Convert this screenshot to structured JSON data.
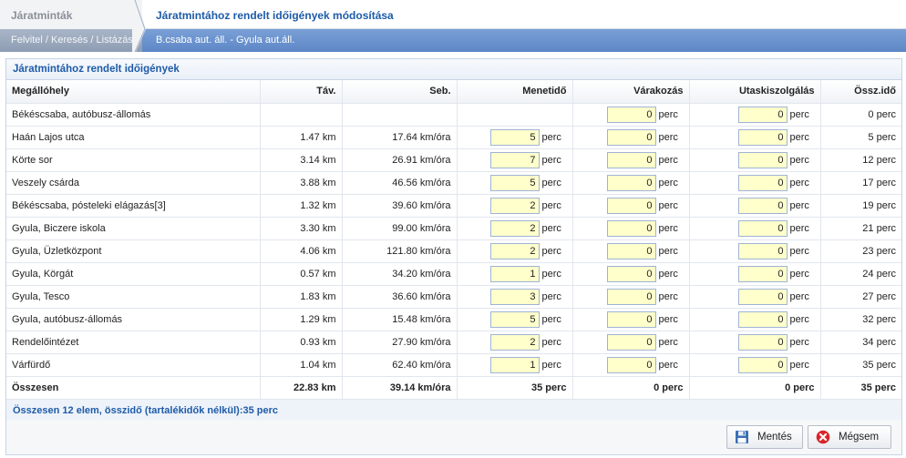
{
  "breadcrumb": {
    "root": "Járatminták",
    "current": "Járatmintához rendelt időigények módosítása",
    "root_sub": "Felvitel / Keresés / Listázás",
    "current_sub": "B.csaba aut. áll. - Gyula aut.áll."
  },
  "panel": {
    "title": "Járatmintához rendelt időigények",
    "summary": "Összesen 12 elem, összidő (tartalékidők nélkül):35 perc"
  },
  "table": {
    "headers": {
      "stop": "Megállóhely",
      "dist": "Táv.",
      "speed": "Seb.",
      "travel": "Menetidő",
      "wait": "Várakozás",
      "service": "Utaskiszolgálás",
      "total": "Össz.idő"
    },
    "unit": "perc",
    "rows": [
      {
        "stop": "Békéscsaba, autóbusz-állomás",
        "dist": "",
        "speed": "",
        "travel": "",
        "wait": "0",
        "service": "0",
        "total": "0 perc"
      },
      {
        "stop": "Haán Lajos utca",
        "dist": "1.47 km",
        "speed": "17.64 km/óra",
        "travel": "5",
        "wait": "0",
        "service": "0",
        "total": "5 perc"
      },
      {
        "stop": "Körte sor",
        "dist": "3.14 km",
        "speed": "26.91 km/óra",
        "travel": "7",
        "wait": "0",
        "service": "0",
        "total": "12 perc"
      },
      {
        "stop": "Veszely csárda",
        "dist": "3.88 km",
        "speed": "46.56 km/óra",
        "travel": "5",
        "wait": "0",
        "service": "0",
        "total": "17 perc"
      },
      {
        "stop": "Békéscsaba, pósteleki elágazás[3]",
        "dist": "1.32 km",
        "speed": "39.60 km/óra",
        "travel": "2",
        "wait": "0",
        "service": "0",
        "total": "19 perc"
      },
      {
        "stop": "Gyula, Biczere iskola",
        "dist": "3.30 km",
        "speed": "99.00 km/óra",
        "travel": "2",
        "wait": "0",
        "service": "0",
        "total": "21 perc"
      },
      {
        "stop": "Gyula, Üzletközpont",
        "dist": "4.06 km",
        "speed": "121.80 km/óra",
        "travel": "2",
        "wait": "0",
        "service": "0",
        "total": "23 perc"
      },
      {
        "stop": "Gyula, Körgát",
        "dist": "0.57 km",
        "speed": "34.20 km/óra",
        "travel": "1",
        "wait": "0",
        "service": "0",
        "total": "24 perc"
      },
      {
        "stop": "Gyula, Tesco",
        "dist": "1.83 km",
        "speed": "36.60 km/óra",
        "travel": "3",
        "wait": "0",
        "service": "0",
        "total": "27 perc"
      },
      {
        "stop": "Gyula, autóbusz-állomás",
        "dist": "1.29 km",
        "speed": "15.48 km/óra",
        "travel": "5",
        "wait": "0",
        "service": "0",
        "total": "32 perc"
      },
      {
        "stop": "Rendelőintézet",
        "dist": "0.93 km",
        "speed": "27.90 km/óra",
        "travel": "2",
        "wait": "0",
        "service": "0",
        "total": "34 perc"
      },
      {
        "stop": "Várfürdő",
        "dist": "1.04 km",
        "speed": "62.40 km/óra",
        "travel": "1",
        "wait": "0",
        "service": "0",
        "total": "35 perc"
      }
    ],
    "totals": {
      "label": "Összesen",
      "dist": "22.83 km",
      "speed": "39.14 km/óra",
      "travel": "35 perc",
      "wait": "0 perc",
      "service": "0 perc",
      "total": "35 perc"
    }
  },
  "buttons": {
    "save": "Mentés",
    "cancel": "Mégsem",
    "save_icon": "floppy-disk-icon",
    "cancel_icon": "cancel-circle-icon"
  },
  "colors": {
    "accent": "#1e5ba8",
    "input_bg": "#ffffcc",
    "header_bar": "#5c86c6"
  }
}
